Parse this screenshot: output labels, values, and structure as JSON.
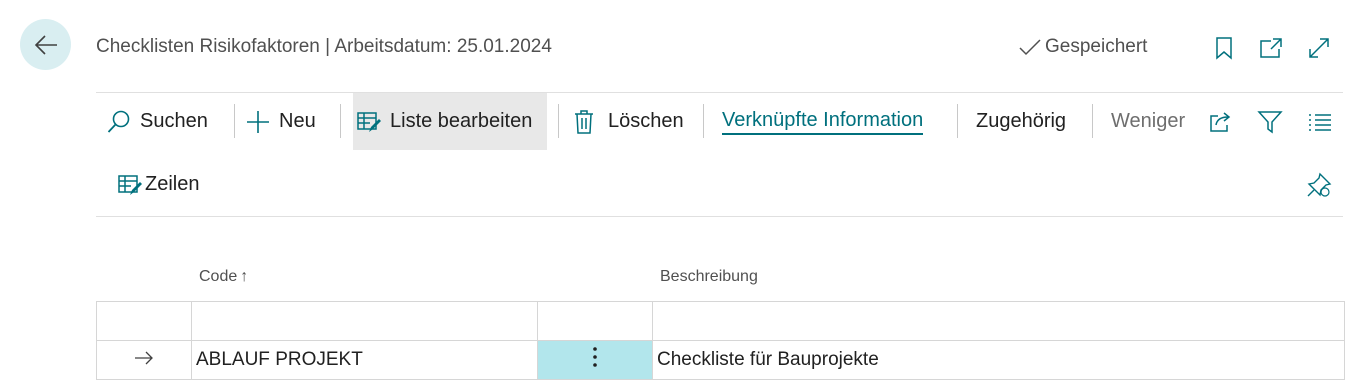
{
  "header": {
    "title": "Checklisten Risikofaktoren | Arbeitsdatum: 25.01.2024",
    "saved_status": "Gespeichert"
  },
  "actions": {
    "search": "Suchen",
    "new": "Neu",
    "edit_list": "Liste bearbeiten",
    "delete": "Löschen",
    "related_info": "Verknüpfte Information",
    "related": "Zugehörig",
    "less": "Weniger",
    "lines": "Zeilen"
  },
  "columns": {
    "code": "Code",
    "code_sort": "↑",
    "description": "Beschreibung"
  },
  "rows": [
    {
      "code": "",
      "description": ""
    },
    {
      "code": "ABLAUF PROJEKT",
      "description": "Checkliste für Bauprojekte",
      "selected": true
    }
  ],
  "colors": {
    "accent": "#00707d",
    "selected_cell": "#b2e6ec",
    "back_button_bg": "#d9eef1"
  }
}
